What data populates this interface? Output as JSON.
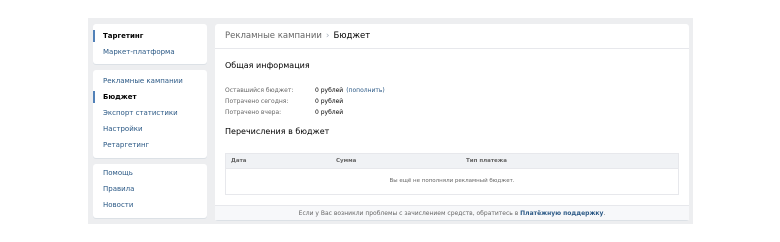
{
  "sidebar": {
    "group1": [
      {
        "label": "Таргетинг",
        "active": true
      },
      {
        "label": "Маркет-платформа",
        "active": false
      }
    ],
    "group2": [
      {
        "label": "Рекламные кампании",
        "active": false
      },
      {
        "label": "Бюджет",
        "active": true
      },
      {
        "label": "Экспорт статистики",
        "active": false
      },
      {
        "label": "Настройки",
        "active": false
      },
      {
        "label": "Ретаргетинг",
        "active": false
      }
    ],
    "group3": [
      {
        "label": "Помощь",
        "active": false
      },
      {
        "label": "Правила",
        "active": false
      },
      {
        "label": "Новости",
        "active": false
      }
    ]
  },
  "breadcrumb": {
    "parent": "Рекламные кампании",
    "separator": "›",
    "current": "Бюджет"
  },
  "general": {
    "title": "Общая информация",
    "rows": [
      {
        "label": "Оставшийся бюджет:",
        "value": "0 рублей",
        "link": "(пополнить)"
      },
      {
        "label": "Потрачено сегодня:",
        "value": "0 рублей",
        "link": ""
      },
      {
        "label": "Потрачено вчера:",
        "value": "0 рублей",
        "link": ""
      }
    ]
  },
  "transfers": {
    "title": "Перечисления в бюджет",
    "columns": [
      "Дата",
      "Сумма",
      "Тип платежа"
    ],
    "empty_text": "Вы ещё не пополняли рекламный бюджет."
  },
  "footer": {
    "text": "Если у Вас возникли проблемы с зачислением средств, обратитесь в",
    "link": "Платёжную поддержку",
    "tail": "."
  },
  "colors": {
    "link": "#2a5885",
    "accent": "#5181b8",
    "background": "#edeef0"
  }
}
